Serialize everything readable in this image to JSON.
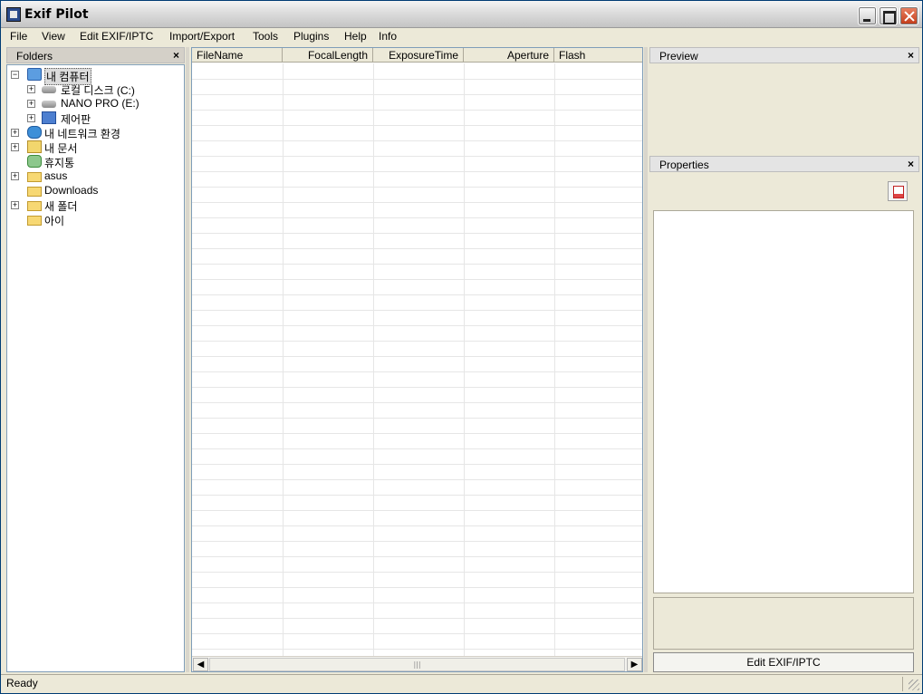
{
  "window": {
    "title": "Exif Pilot"
  },
  "menu": [
    "File",
    "View",
    "Edit EXIF/IPTC",
    "Import/Export",
    "Tools",
    "Plugins",
    "Help",
    "Info"
  ],
  "folders": {
    "header": "Folders",
    "tree": [
      {
        "label": "내 컴퓨터",
        "icon": "computer-icon",
        "expander": "−",
        "selected": true
      },
      {
        "label": "로컬 디스크 (C:)",
        "icon": "disk-icon",
        "expander": "+"
      },
      {
        "label": "NANO PRO (E:)",
        "icon": "disk-icon",
        "expander": "+"
      },
      {
        "label": "제어판",
        "icon": "control-panel-icon",
        "expander": "+"
      },
      {
        "label": "내 네트워크 환경",
        "icon": "network-icon",
        "expander": "+"
      },
      {
        "label": "내 문서",
        "icon": "documents-icon",
        "expander": "+"
      },
      {
        "label": "휴지통",
        "icon": "recycle-bin-icon",
        "expander": ""
      },
      {
        "label": "asus",
        "icon": "folder-icon",
        "expander": "+"
      },
      {
        "label": "Downloads",
        "icon": "folder-icon",
        "expander": ""
      },
      {
        "label": "새 폴더",
        "icon": "folder-icon",
        "expander": "+"
      },
      {
        "label": "아이",
        "icon": "folder-icon",
        "expander": ""
      }
    ]
  },
  "grid": {
    "columns": [
      "FileName",
      "FocalLength",
      "ExposureTime",
      "Aperture",
      "Flash"
    ],
    "rows": []
  },
  "preview": {
    "header": "Preview"
  },
  "properties": {
    "header": "Properties",
    "button_label": "Edit EXIF/IPTC"
  },
  "status": {
    "text": "Ready"
  }
}
